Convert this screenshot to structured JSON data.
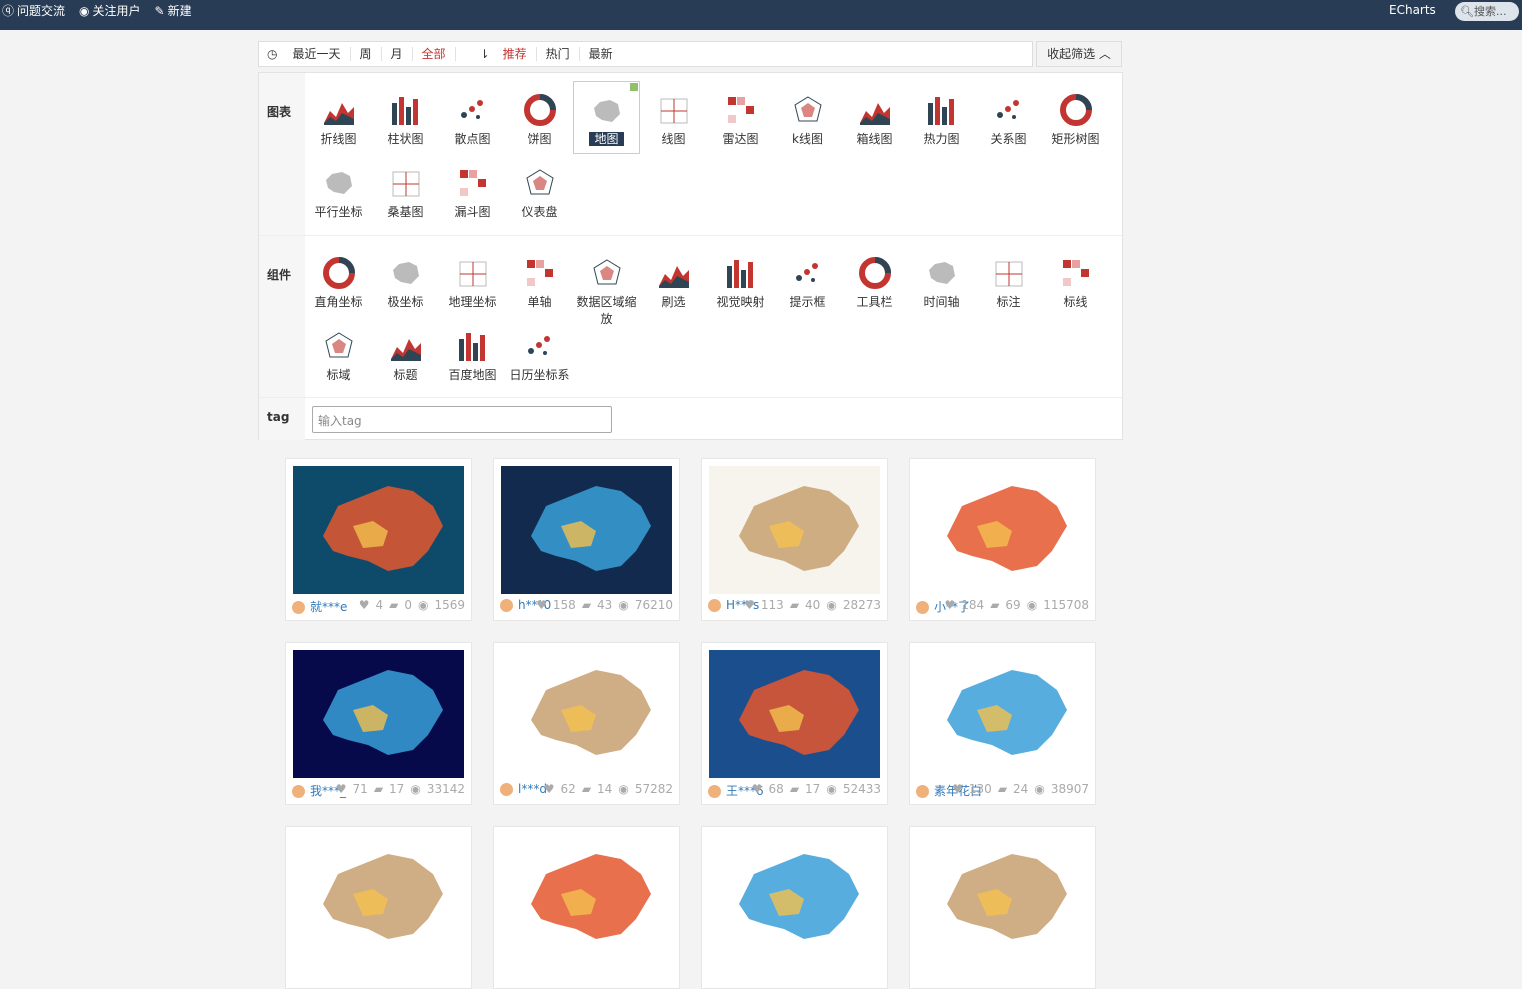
{
  "topbar": {
    "nav": [
      "问题交流",
      "关注用户",
      "新建"
    ],
    "brand": "ECharts",
    "search_placeholder": "搜索..."
  },
  "filters": {
    "time": [
      "最近一天",
      "周",
      "月"
    ],
    "all": "全部",
    "sort": [
      "推荐",
      "热门",
      "最新"
    ],
    "collapse": "收起筛选"
  },
  "chart_section": {
    "label": "图表",
    "items": [
      "折线图",
      "柱状图",
      "散点图",
      "饼图",
      "地图",
      "线图",
      "雷达图",
      "k线图",
      "箱线图",
      "热力图",
      "关系图",
      "矩形树图",
      "平行坐标",
      "桑基图",
      "漏斗图",
      "仪表盘"
    ],
    "selected": "地图"
  },
  "component_section": {
    "label": "组件",
    "items": [
      "直角坐标",
      "极坐标",
      "地理坐标",
      "单轴",
      "数据区域缩放",
      "刷选",
      "视觉映射",
      "提示框",
      "工具栏",
      "时间轴",
      "标注",
      "标线",
      "标域",
      "标题",
      "百度地图",
      "日历坐标系"
    ]
  },
  "tag_section": {
    "label": "tag",
    "placeholder": "输入tag"
  },
  "cards": [
    {
      "user": "就***e",
      "likes": "4",
      "comments": "0",
      "views": "1569",
      "bg": "#0e4b6a"
    },
    {
      "user": "h***0",
      "likes": "158",
      "comments": "43",
      "views": "76210",
      "bg": "#112a4e"
    },
    {
      "user": "H***s",
      "likes": "113",
      "comments": "40",
      "views": "28273",
      "bg": "#f7f4ee"
    },
    {
      "user": "小**了",
      "likes": "184",
      "comments": "69",
      "views": "115708",
      "bg": "#ffffff"
    },
    {
      "user": "我***_",
      "likes": "71",
      "comments": "17",
      "views": "33142",
      "bg": "#06094a"
    },
    {
      "user": "l***d",
      "likes": "62",
      "comments": "14",
      "views": "57282",
      "bg": "#ffffff"
    },
    {
      "user": "王***6",
      "likes": "68",
      "comments": "17",
      "views": "52433",
      "bg": "#1b4e8c"
    },
    {
      "user": "素年花白",
      "likes": "130",
      "comments": "24",
      "views": "38907",
      "bg": "#ffffff"
    },
    {
      "user": "",
      "likes": "",
      "comments": "",
      "views": "",
      "bg": "#ffffff"
    },
    {
      "user": "",
      "likes": "",
      "comments": "",
      "views": "",
      "bg": "#ffffff"
    },
    {
      "user": "",
      "likes": "",
      "comments": "",
      "views": "",
      "bg": "#ffffff"
    },
    {
      "user": "",
      "likes": "",
      "comments": "",
      "views": "",
      "bg": "#ffffff"
    }
  ]
}
